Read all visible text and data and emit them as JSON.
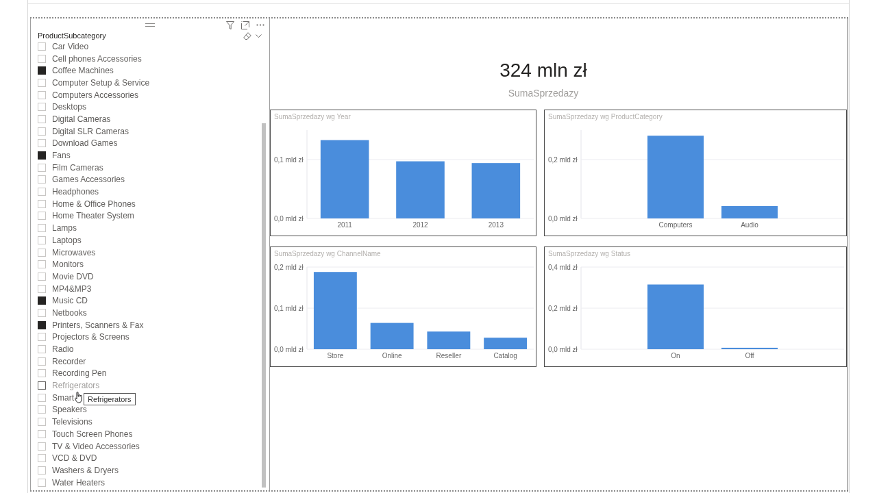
{
  "slicer": {
    "title": "ProductSubcategory",
    "items": [
      {
        "label": "Car Video",
        "checked": false,
        "hovered": false
      },
      {
        "label": "Cell phones Accessories",
        "checked": false,
        "hovered": false
      },
      {
        "label": "Coffee Machines",
        "checked": true,
        "hovered": false
      },
      {
        "label": "Computer Setup & Service",
        "checked": false,
        "hovered": false
      },
      {
        "label": "Computers Accessories",
        "checked": false,
        "hovered": false
      },
      {
        "label": "Desktops",
        "checked": false,
        "hovered": false
      },
      {
        "label": "Digital Cameras",
        "checked": false,
        "hovered": false
      },
      {
        "label": "Digital SLR Cameras",
        "checked": false,
        "hovered": false
      },
      {
        "label": "Download Games",
        "checked": false,
        "hovered": false
      },
      {
        "label": "Fans",
        "checked": true,
        "hovered": false
      },
      {
        "label": "Film Cameras",
        "checked": false,
        "hovered": false
      },
      {
        "label": "Games Accessories",
        "checked": false,
        "hovered": false
      },
      {
        "label": "Headphones",
        "checked": false,
        "hovered": false
      },
      {
        "label": "Home & Office Phones",
        "checked": false,
        "hovered": false
      },
      {
        "label": "Home Theater System",
        "checked": false,
        "hovered": false
      },
      {
        "label": "Lamps",
        "checked": false,
        "hovered": false
      },
      {
        "label": "Laptops",
        "checked": false,
        "hovered": false
      },
      {
        "label": "Microwaves",
        "checked": false,
        "hovered": false
      },
      {
        "label": "Monitors",
        "checked": false,
        "hovered": false
      },
      {
        "label": "Movie DVD",
        "checked": false,
        "hovered": false
      },
      {
        "label": "MP4&MP3",
        "checked": false,
        "hovered": false
      },
      {
        "label": "Music CD",
        "checked": true,
        "hovered": false
      },
      {
        "label": "Netbooks",
        "checked": false,
        "hovered": false
      },
      {
        "label": "Printers, Scanners & Fax",
        "checked": true,
        "hovered": false
      },
      {
        "label": "Projectors & Screens",
        "checked": false,
        "hovered": false
      },
      {
        "label": "Radio",
        "checked": false,
        "hovered": false
      },
      {
        "label": "Recorder",
        "checked": false,
        "hovered": false
      },
      {
        "label": "Recording Pen",
        "checked": false,
        "hovered": false
      },
      {
        "label": "Refrigerators",
        "checked": false,
        "hovered": true
      },
      {
        "label": "Smart",
        "checked": false,
        "hovered": false
      },
      {
        "label": "Speakers",
        "checked": false,
        "hovered": false
      },
      {
        "label": "Televisions",
        "checked": false,
        "hovered": false
      },
      {
        "label": "Touch Screen Phones",
        "checked": false,
        "hovered": false
      },
      {
        "label": "TV & Video Accessories",
        "checked": false,
        "hovered": false
      },
      {
        "label": "VCD & DVD",
        "checked": false,
        "hovered": false
      },
      {
        "label": "Washers & Dryers",
        "checked": false,
        "hovered": false
      },
      {
        "label": "Water Heaters",
        "checked": false,
        "hovered": false
      }
    ],
    "tooltip": "Refrigerators"
  },
  "card": {
    "value": "324 mln zł",
    "label": "SumaSprzedazy"
  },
  "charts": [
    {
      "chart_data": {
        "type": "bar",
        "title": "SumaSprzedazy wg Year",
        "categories": [
          "2011",
          "2012",
          "2013"
        ],
        "values": [
          0.133,
          0.097,
          0.094
        ],
        "ylim": [
          0,
          0.15
        ],
        "yticks": [
          {
            "value": 0,
            "label": "0,0 mld zł"
          },
          {
            "value": 0.1,
            "label": "0,1 mld zł"
          }
        ]
      }
    },
    {
      "chart_data": {
        "type": "bar",
        "title": "SumaSprzedazy wg ProductCategory",
        "categories": [
          "Computers",
          "Audio"
        ],
        "values": [
          0.281,
          0.042
        ],
        "ylim": [
          0,
          0.3
        ],
        "yticks": [
          {
            "value": 0,
            "label": "0,0 mld zł"
          },
          {
            "value": 0.2,
            "label": "0,2 mld zł"
          }
        ]
      }
    },
    {
      "chart_data": {
        "type": "bar",
        "title": "SumaSprzedazy wg ChannelName",
        "categories": [
          "Store",
          "Online",
          "Reseller",
          "Catalog"
        ],
        "values": [
          0.188,
          0.064,
          0.043,
          0.028
        ],
        "ylim": [
          0,
          0.2
        ],
        "yticks": [
          {
            "value": 0,
            "label": "0,0 mld zł"
          },
          {
            "value": 0.1,
            "label": "0,1 mld zł"
          },
          {
            "value": 0.2,
            "label": "0,2 mld zł"
          }
        ]
      }
    },
    {
      "chart_data": {
        "type": "bar",
        "title": "SumaSprzedazy wg Status",
        "categories": [
          "On",
          "Off"
        ],
        "values": [
          0.315,
          0.007
        ],
        "ylim": [
          0,
          0.4
        ],
        "yticks": [
          {
            "value": 0,
            "label": "0,0 mld zł"
          },
          {
            "value": 0.2,
            "label": "0,2 mld zł"
          },
          {
            "value": 0.4,
            "label": "0,4 mld zł"
          }
        ]
      }
    }
  ]
}
